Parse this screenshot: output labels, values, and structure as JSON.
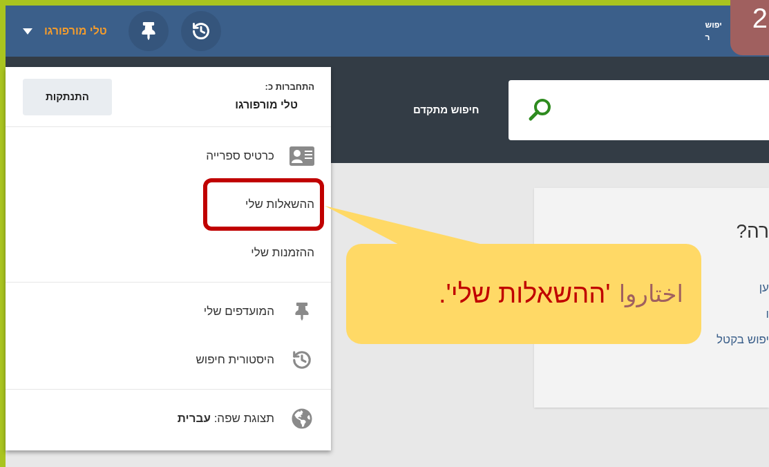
{
  "header": {
    "user_menu": {
      "label": "טלי מורפורגו",
      "expanded": true
    },
    "text_top": "יפוש",
    "text_bottom": "ר"
  },
  "search": {
    "advanced_link": "חיפוש מתקדם"
  },
  "account_menu": {
    "signed_in_label": "התחברות כ:",
    "user_name": "טלי מורפורגו",
    "logout_button": "התנתקות",
    "sections": [
      {
        "items": [
          {
            "label": "כרטיס ספרייה",
            "kind": "card",
            "highlighted": false
          },
          {
            "label": "ההשאלות שלי",
            "kind": "plain",
            "highlighted": true
          },
          {
            "label": "ההזמנות שלי",
            "kind": "plain",
            "highlighted": false
          }
        ]
      },
      {
        "items": [
          {
            "label": "המועדפים שלי",
            "kind": "favorites",
            "highlighted": false
          },
          {
            "label": "היסטורית חיפוש",
            "kind": "history",
            "highlighted": false
          }
        ]
      },
      {
        "items": [
          {
            "label": "תצוגת שפה: **עברית**",
            "kind": "language",
            "highlighted": false
          }
        ]
      }
    ]
  },
  "card": {
    "title": "רה?",
    "lines": [
      "ען",
      "ו",
      "יפוש בקטל"
    ]
  },
  "annotation": {
    "step": "2",
    "callout_lead": "اختاروا",
    "callout_highlight": "'ההשאלות שלי'."
  }
}
